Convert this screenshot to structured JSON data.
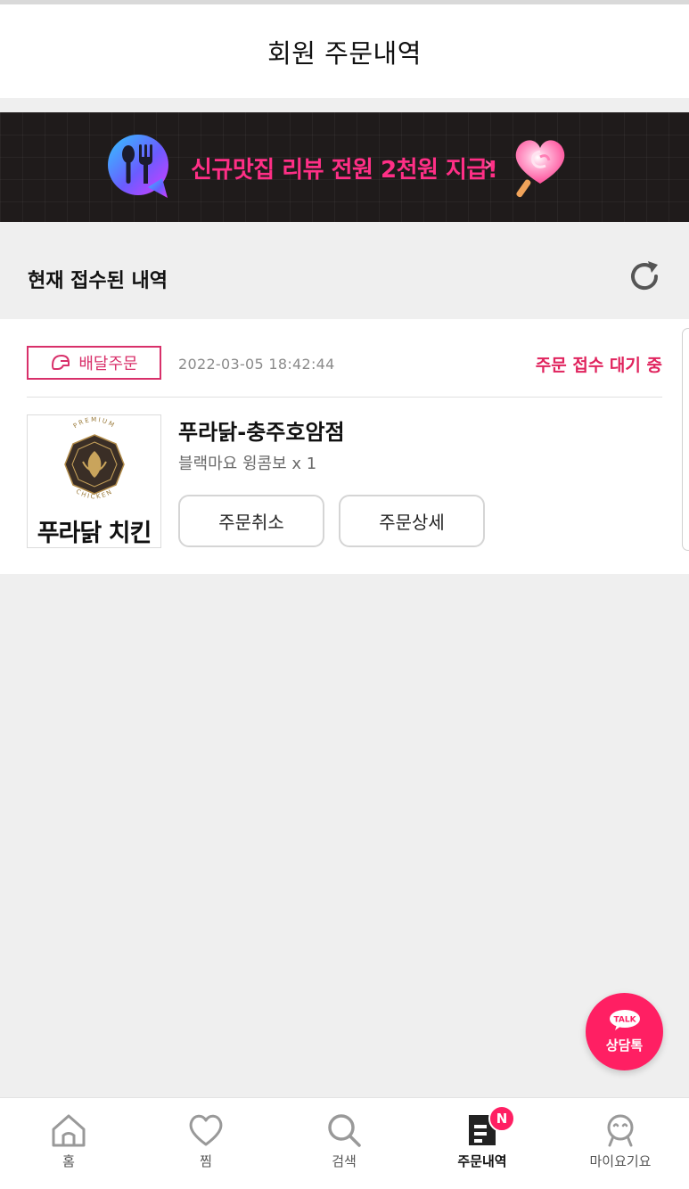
{
  "header": {
    "title": "회원 주문내역"
  },
  "banner": {
    "text": "신규맛집 리뷰 전원 2천원 지급!",
    "chevron": "›"
  },
  "section": {
    "title": "현재 접수된 내역"
  },
  "order": {
    "type_label": "배달주문",
    "time": "2022-03-05 18:42:44",
    "status": "주문 접수 대기 중",
    "store_name": "푸라닭-충주호암점",
    "items": "블랙마요 윙콤보 x 1",
    "logo_text": "푸라닭 치킨",
    "logo_premium": "PREMIUM",
    "logo_chicken": "CHICKEN",
    "cancel_label": "주문취소",
    "detail_label": "주문상세"
  },
  "talk": {
    "bubble": "TALK",
    "label": "상담톡"
  },
  "nav": {
    "items": [
      {
        "label": "홈",
        "icon": "home-icon"
      },
      {
        "label": "찜",
        "icon": "heart-icon"
      },
      {
        "label": "검색",
        "icon": "search-icon"
      },
      {
        "label": "주문내역",
        "icon": "order-list-icon",
        "badge": "N"
      },
      {
        "label": "마이요기요",
        "icon": "profile-icon"
      }
    ]
  },
  "colors": {
    "accent": "#e0245e",
    "talk": "#ff1f63",
    "banner_bg": "#1f1b1b"
  }
}
